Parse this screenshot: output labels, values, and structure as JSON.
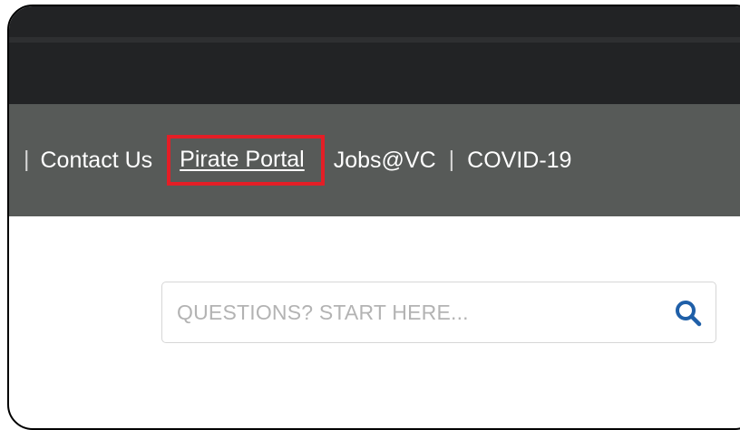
{
  "nav": {
    "separator": "|",
    "contact_us": "Contact Us",
    "pirate_portal": "Pirate Portal",
    "jobs": "Jobs@VC",
    "covid": "COVID-19"
  },
  "search": {
    "placeholder": "QUESTIONS? START HERE...",
    "value": "",
    "icon": "search-icon"
  },
  "colors": {
    "top_bar": "#222325",
    "nav_bar": "#575a58",
    "highlight": "#e41e26",
    "search_icon": "#1f5fa8"
  }
}
